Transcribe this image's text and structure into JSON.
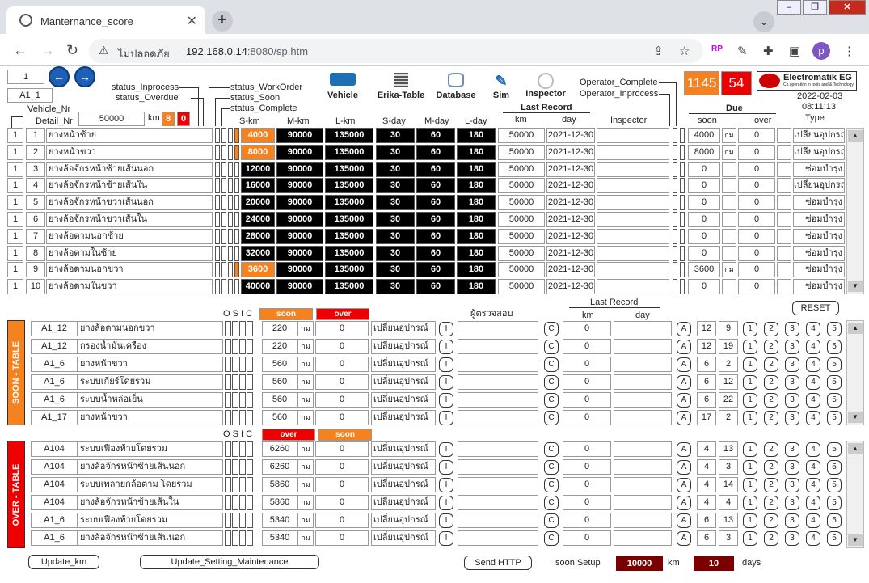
{
  "browser": {
    "tab_title": "Manternance_score",
    "insecure": "ไม่ปลอดภัย",
    "url_host": "192.168.0.14",
    "url_rest": ":8080/sp.htm"
  },
  "header": {
    "page_num": "1",
    "vehicle_id": "A1_1",
    "vehicle_nr": "Vehicle_Nr",
    "detail_nr": "Detail_Nr",
    "km_value": "50000",
    "km_unit": "km",
    "count_orange": "8",
    "count_red": "0",
    "status_inprocess": "status_Inprocess",
    "status_overdue": "status_Overdue",
    "status_workorder": "status_WorkOrder",
    "status_soon": "status_Soon",
    "status_complete": "status_Complete",
    "tools": [
      "Vehicle",
      "Erika-Table",
      "Database",
      "Sim",
      "Inspector"
    ],
    "operator_complete": "Operator_Complete",
    "operator_inprocess": "Operator_Inprocess",
    "big_count": "1145",
    "big_red": "54",
    "logo": "Electromatik EG",
    "logo_sub": "Co.operation in tools and & Technology",
    "date": "2022-02-03",
    "time": "08:11:13",
    "last_record": "Last Record",
    "due": "Due"
  },
  "cols": {
    "skm": "S-km",
    "mkm": "M-km",
    "lkm": "L-km",
    "sday": "S-day",
    "mday": "M-day",
    "lday": "L-day",
    "km": "km",
    "day": "day",
    "inspector": "Inspector",
    "soon": "soon",
    "over": "over",
    "type": "Type"
  },
  "main_rows": [
    {
      "a": "1",
      "b": "1",
      "name": "ยางหน้าซ้าย",
      "s": "4000",
      "m": "90000",
      "l": "135000",
      "sd": "30",
      "md": "60",
      "ld": "180",
      "km": "50000",
      "day": "2021-12-30",
      "soon": "4000",
      "unit": "กม",
      "over": "0",
      "type": "เปลี่ยนอุปกรณ์",
      "hl": true,
      "st": true
    },
    {
      "a": "1",
      "b": "2",
      "name": "ยางหน้าขวา",
      "s": "8000",
      "m": "90000",
      "l": "135000",
      "sd": "30",
      "md": "60",
      "ld": "180",
      "km": "50000",
      "day": "2021-12-30",
      "soon": "8000",
      "unit": "กม",
      "over": "0",
      "type": "เปลี่ยนอุปกรณ์",
      "hl": true,
      "st": true
    },
    {
      "a": "1",
      "b": "3",
      "name": "ยางล้อจักรหน้าซ้ายเส้นนอก",
      "s": "12000",
      "m": "90000",
      "l": "135000",
      "sd": "30",
      "md": "60",
      "ld": "180",
      "km": "50000",
      "day": "2021-12-30",
      "soon": "0",
      "unit": "",
      "over": "0",
      "type": "ซ่อมบำรุง",
      "hl": false,
      "st": false
    },
    {
      "a": "1",
      "b": "4",
      "name": "ยางล้อจักรหน้าซ้ายเส้นใน",
      "s": "16000",
      "m": "90000",
      "l": "135000",
      "sd": "30",
      "md": "60",
      "ld": "180",
      "km": "50000",
      "day": "2021-12-30",
      "soon": "0",
      "unit": "",
      "over": "0",
      "type": "เปลี่ยนอุปกรณ์",
      "hl": false,
      "st": false
    },
    {
      "a": "1",
      "b": "5",
      "name": "ยางล้อจักรหน้าขวาเส้นนอก",
      "s": "20000",
      "m": "90000",
      "l": "135000",
      "sd": "30",
      "md": "60",
      "ld": "180",
      "km": "50000",
      "day": "2021-12-30",
      "soon": "0",
      "unit": "",
      "over": "0",
      "type": "ซ่อมบำรุง",
      "hl": false,
      "st": false
    },
    {
      "a": "1",
      "b": "6",
      "name": "ยางล้อจักรหน้าขวาเส้นใน",
      "s": "24000",
      "m": "90000",
      "l": "135000",
      "sd": "30",
      "md": "60",
      "ld": "180",
      "km": "50000",
      "day": "2021-12-30",
      "soon": "0",
      "unit": "",
      "over": "0",
      "type": "ซ่อมบำรุง",
      "hl": false,
      "st": false
    },
    {
      "a": "1",
      "b": "7",
      "name": "ยางล้อตามนอกซ้าย",
      "s": "28000",
      "m": "90000",
      "l": "135000",
      "sd": "30",
      "md": "60",
      "ld": "180",
      "km": "50000",
      "day": "2021-12-30",
      "soon": "0",
      "unit": "",
      "over": "0",
      "type": "ซ่อมบำรุง",
      "hl": false,
      "st": false
    },
    {
      "a": "1",
      "b": "8",
      "name": "ยางล้อตามในซ้าย",
      "s": "32000",
      "m": "90000",
      "l": "135000",
      "sd": "30",
      "md": "60",
      "ld": "180",
      "km": "50000",
      "day": "2021-12-30",
      "soon": "0",
      "unit": "",
      "over": "0",
      "type": "ซ่อมบำรุง",
      "hl": false,
      "st": false
    },
    {
      "a": "1",
      "b": "9",
      "name": "ยางล้อตามนอกขวา",
      "s": "3600",
      "m": "90000",
      "l": "135000",
      "sd": "30",
      "md": "60",
      "ld": "180",
      "km": "50000",
      "day": "2021-12-30",
      "soon": "3600",
      "unit": "กม",
      "over": "0",
      "type": "ซ่อมบำรุง",
      "hl": true,
      "st": true
    },
    {
      "a": "1",
      "b": "10",
      "name": "ยางล้อตามในขวา",
      "s": "40000",
      "m": "90000",
      "l": "135000",
      "sd": "30",
      "md": "60",
      "ld": "180",
      "km": "50000",
      "day": "2021-12-30",
      "soon": "0",
      "unit": "",
      "over": "0",
      "type": "ซ่อมบำรุง",
      "hl": false,
      "st": false
    }
  ],
  "osic": "O S I C",
  "soon_table": {
    "label": "SOON - TABLE",
    "h1": "soon",
    "h2": "over",
    "inspector": "ผู้ตรวจสอบ",
    "last_record": "Last Record",
    "km": "km",
    "day": "day",
    "reset": "RESET",
    "rows": [
      {
        "id": "A1_12",
        "name": "ยางล้อตามนอกขวา",
        "v1": "220",
        "unit": "กม",
        "v2": "0",
        "type": "เปลี่ยนอุปกรณ์",
        "i": "I",
        "c": "C",
        "rk": "0",
        "a": "A",
        "n1": "12",
        "n2": "9"
      },
      {
        "id": "A1_12",
        "name": "กรองน้ำมันเครื่อง",
        "v1": "220",
        "unit": "กม",
        "v2": "0",
        "type": "เปลี่ยนอุปกรณ์",
        "i": "I",
        "c": "C",
        "rk": "0",
        "a": "A",
        "n1": "12",
        "n2": "19"
      },
      {
        "id": "A1_6",
        "name": "ยางหน้าขวา",
        "v1": "560",
        "unit": "กม",
        "v2": "0",
        "type": "เปลี่ยนอุปกรณ์",
        "i": "I",
        "c": "C",
        "rk": "0",
        "a": "A",
        "n1": "6",
        "n2": "2"
      },
      {
        "id": "A1_6",
        "name": "ระบบเกียร์โดยรวม",
        "v1": "560",
        "unit": "กม",
        "v2": "0",
        "type": "เปลี่ยนอุปกรณ์",
        "i": "I",
        "c": "C",
        "rk": "0",
        "a": "A",
        "n1": "6",
        "n2": "12"
      },
      {
        "id": "A1_6",
        "name": "ระบบน้ำหล่อเย็น",
        "v1": "560",
        "unit": "กม",
        "v2": "0",
        "type": "เปลี่ยนอุปกรณ์",
        "i": "I",
        "c": "C",
        "rk": "0",
        "a": "A",
        "n1": "6",
        "n2": "22"
      },
      {
        "id": "A1_17",
        "name": "ยางหน้าขวา",
        "v1": "560",
        "unit": "กม",
        "v2": "0",
        "type": "เปลี่ยนอุปกรณ์",
        "i": "I",
        "c": "C",
        "rk": "0",
        "a": "A",
        "n1": "17",
        "n2": "2"
      }
    ]
  },
  "over_table": {
    "label": "OVER - TABLE",
    "h1": "over",
    "h2": "soon",
    "rows": [
      {
        "id": "A104",
        "name": "ระบบเฟืองท้ายโดยรวม",
        "v1": "6260",
        "unit": "กม",
        "v2": "0",
        "type": "เปลี่ยนอุปกรณ์",
        "i": "I",
        "c": "C",
        "rk": "0",
        "a": "A",
        "n1": "4",
        "n2": "13"
      },
      {
        "id": "A104",
        "name": "ยางล้อจักรหน้าซ้ายเส้นนอก",
        "v1": "6260",
        "unit": "กม",
        "v2": "0",
        "type": "เปลี่ยนอุปกรณ์",
        "i": "I",
        "c": "C",
        "rk": "0",
        "a": "A",
        "n1": "4",
        "n2": "3"
      },
      {
        "id": "A104",
        "name": "ระบบเพลายกล้อตาม โดยรวม",
        "v1": "5860",
        "unit": "กม",
        "v2": "0",
        "type": "เปลี่ยนอุปกรณ์",
        "i": "I",
        "c": "C",
        "rk": "0",
        "a": "A",
        "n1": "4",
        "n2": "14"
      },
      {
        "id": "A104",
        "name": "ยางล้อจักรหน้าซ้ายเส้นใน",
        "v1": "5860",
        "unit": "กม",
        "v2": "0",
        "type": "เปลี่ยนอุปกรณ์",
        "i": "I",
        "c": "C",
        "rk": "0",
        "a": "A",
        "n1": "4",
        "n2": "4"
      },
      {
        "id": "A1_6",
        "name": "ระบบเฟืองท้ายโดยรวม",
        "v1": "5340",
        "unit": "กม",
        "v2": "0",
        "type": "เปลี่ยนอุปกรณ์",
        "i": "I",
        "c": "C",
        "rk": "0",
        "a": "A",
        "n1": "6",
        "n2": "13"
      },
      {
        "id": "A1_6",
        "name": "ยางล้อจักรหน้าซ้ายเส้นนอก",
        "v1": "5340",
        "unit": "กม",
        "v2": "0",
        "type": "เปลี่ยนอุปกรณ์",
        "i": "I",
        "c": "C",
        "rk": "0",
        "a": "A",
        "n1": "6",
        "n2": "3"
      }
    ]
  },
  "steps": [
    "1",
    "2",
    "3",
    "4",
    "5"
  ],
  "footer": {
    "update_km": "Update_km",
    "update_setting": "Update_Setting_Maintenance",
    "send_http": "Send HTTP",
    "soon_setup": "soon Setup",
    "setup_km": "10000",
    "km": "km",
    "setup_days": "10",
    "days": "days"
  }
}
